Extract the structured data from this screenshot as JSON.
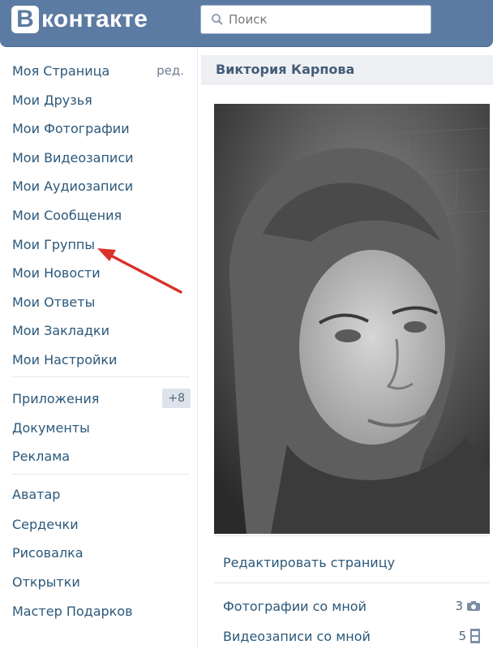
{
  "header": {
    "logo_letter": "B",
    "logo_text": "контакте",
    "search_placeholder": "Поиск"
  },
  "sidebar": {
    "main_items": [
      {
        "label": "Моя Страница",
        "edit_label": "ред."
      },
      {
        "label": "Мои Друзья"
      },
      {
        "label": "Мои Фотографии"
      },
      {
        "label": "Мои Видеозаписи"
      },
      {
        "label": "Мои Аудиозаписи"
      },
      {
        "label": "Мои Сообщения"
      },
      {
        "label": "Мои Группы"
      },
      {
        "label": "Мои Новости"
      },
      {
        "label": "Мои Ответы"
      },
      {
        "label": "Мои Закладки"
      },
      {
        "label": "Мои Настройки"
      }
    ],
    "apps_items": [
      {
        "label": "Приложения",
        "badge": "+8"
      },
      {
        "label": "Документы"
      },
      {
        "label": "Реклама"
      }
    ],
    "extra_items": [
      {
        "label": "Аватар"
      },
      {
        "label": "Сердечки"
      },
      {
        "label": "Рисовалка"
      },
      {
        "label": "Открытки"
      },
      {
        "label": "Мастер Подарков"
      }
    ]
  },
  "annotation": {
    "arrow_color": "#d9312b",
    "points_to": "Мои Группы"
  },
  "profile": {
    "name": "Виктория Карпова",
    "edit_link": "Редактировать страницу",
    "links": [
      {
        "label": "Фотографии со мной",
        "count": "3",
        "icon": "camera-icon"
      },
      {
        "label": "Видеозаписи со мной",
        "count": "5",
        "icon": "film-icon"
      }
    ]
  },
  "colors": {
    "header_bg": "#5c7ba2",
    "link": "#2b587a"
  }
}
